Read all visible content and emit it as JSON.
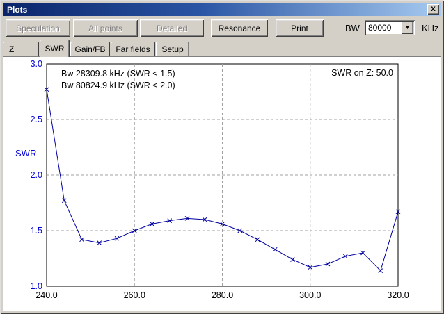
{
  "window": {
    "title": "Plots"
  },
  "icons": {
    "close": "x",
    "dropdown": "▼"
  },
  "toolbar": {
    "buttons": [
      {
        "label": "Speculation",
        "enabled": false
      },
      {
        "label": "All points",
        "enabled": false
      },
      {
        "label": "Detailed",
        "enabled": false
      },
      {
        "label": "Resonance",
        "enabled": true
      },
      {
        "label": "Print",
        "enabled": true
      }
    ],
    "bw_label": "BW",
    "bw_value": "80000",
    "unit_label": "KHz"
  },
  "tabs": [
    {
      "label": "Z",
      "active": false
    },
    {
      "label": "SWR",
      "active": true
    },
    {
      "label": "Gain/FB",
      "active": false
    },
    {
      "label": "Far fields",
      "active": false
    },
    {
      "label": "Setup",
      "active": false
    }
  ],
  "chart_data": {
    "type": "line",
    "title": "",
    "xlabel": "",
    "ylabel": "SWR",
    "xlim": [
      240,
      320
    ],
    "ylim": [
      1.0,
      3.0
    ],
    "grid": true,
    "line_color": "#0000a0",
    "marker": "x",
    "axis_label_color": "#0000d8",
    "x_tick_color": "#000000",
    "grid_color": "#a0a0a0",
    "x": [
      240,
      244,
      248,
      252,
      256,
      260,
      264,
      268,
      272,
      276,
      280,
      284,
      288,
      292,
      296,
      300,
      304,
      308,
      312,
      316,
      320
    ],
    "y": [
      2.77,
      1.77,
      1.42,
      1.39,
      1.43,
      1.5,
      1.56,
      1.59,
      1.61,
      1.6,
      1.56,
      1.5,
      1.42,
      1.33,
      1.24,
      1.17,
      1.2,
      1.27,
      1.3,
      1.14,
      1.67
    ],
    "x_ticks": [
      {
        "value": 240,
        "label": "240.0"
      },
      {
        "value": 260,
        "label": "260.0"
      },
      {
        "value": 280,
        "label": "280.0"
      },
      {
        "value": 300,
        "label": "300.0"
      },
      {
        "value": 320,
        "label": "320.0"
      }
    ],
    "y_ticks": [
      {
        "value": 3.0,
        "label": "3.0"
      },
      {
        "value": 2.5,
        "label": "2.5"
      },
      {
        "value": 2.0,
        "label": "2.0"
      },
      {
        "value": 1.5,
        "label": "1.5"
      },
      {
        "value": 1.0,
        "label": "1.0"
      }
    ],
    "annotations": [
      "Bw 28309.8 kHz (SWR < 1.5)",
      "Bw 80824.9 kHz (SWR < 2.0)"
    ],
    "annotation_right": "SWR on Z: 50.0"
  }
}
